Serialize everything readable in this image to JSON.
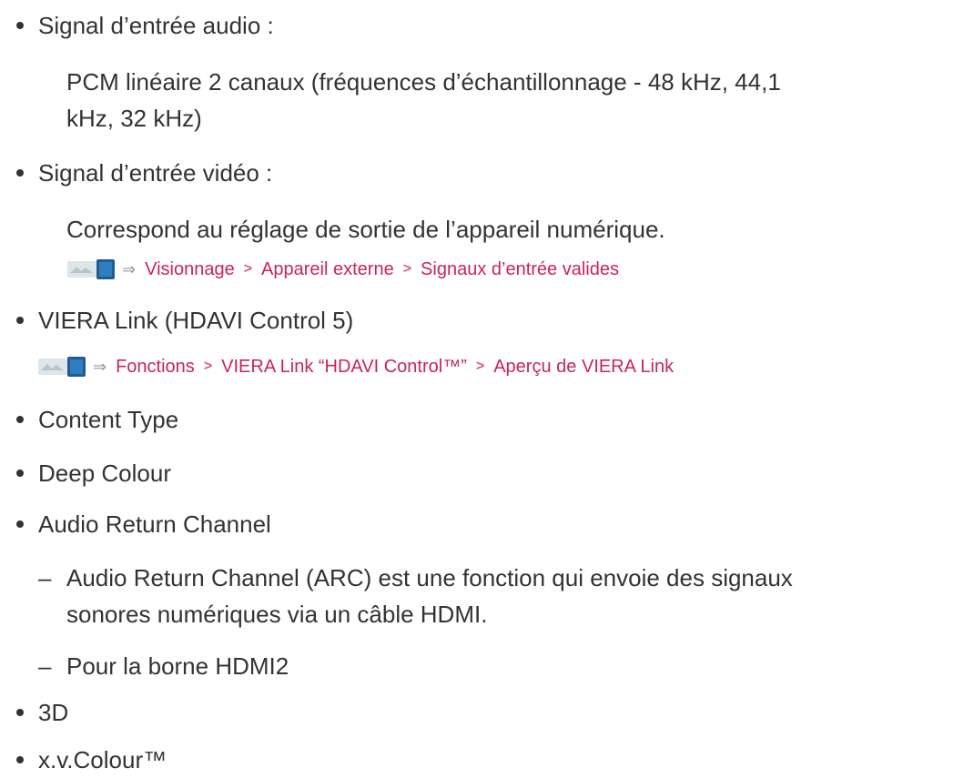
{
  "items": [
    {
      "text": "Signal d’entrée audio :"
    },
    {
      "text": "Signal d’entrée vidéo :"
    },
    {
      "text": "VIERA Link (HDAVI Control 5)"
    },
    {
      "text": "Content Type"
    },
    {
      "text": "Deep Colour"
    },
    {
      "text": "Audio Return Channel"
    },
    {
      "text": "3D"
    },
    {
      "text": "x.v.Colour™"
    }
  ],
  "audio_desc_line1": "PCM linéaire 2 canaux (fréquences d’échantillonnage - 48 kHz, 44,1",
  "audio_desc_line2": "kHz, 32 kHz)",
  "video_desc": "Correspond au réglage de sortie de l’appareil numérique.",
  "nav1": {
    "icon": "tv-menu-icon",
    "links": [
      "Visionnage",
      "Appareil externe",
      "Signaux d’entrée valides"
    ]
  },
  "nav2": {
    "icon": "tv-menu-icon",
    "links": [
      "Fonctions",
      "VIERA Link “HDAVI Control™”",
      "Aperçu de VIERA Link"
    ]
  },
  "arc_sub": [
    {
      "line1": "Audio Return Channel (ARC) est une fonction qui envoie des signaux",
      "line2": "sonores numériques via un câble HDMI."
    },
    {
      "line1": "Pour la borne HDMI2"
    }
  ],
  "symbols": {
    "dash": "–",
    "arrow": "⇒",
    "separator": ">"
  },
  "colors": {
    "text": "#333333",
    "link": "#c9245a",
    "separator": "#d45c84"
  }
}
